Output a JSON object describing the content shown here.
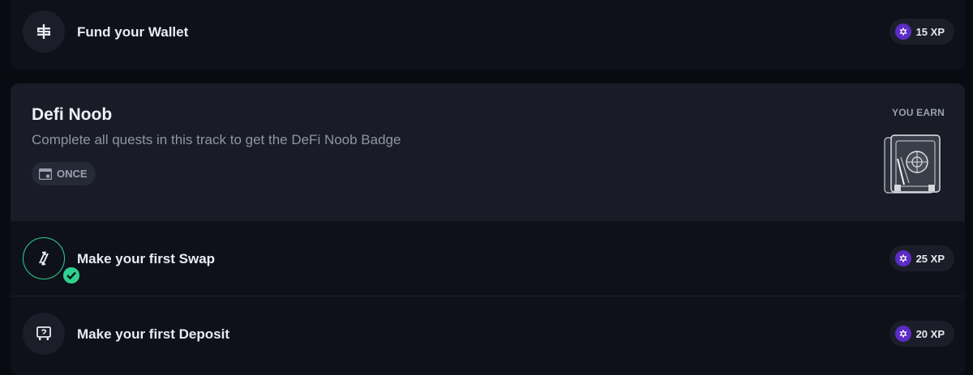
{
  "quests_top": {
    "fund_wallet": {
      "label": "Fund your Wallet",
      "xp": "15 XP",
      "icon": "dollar-icon"
    }
  },
  "track": {
    "title": "Defi Noob",
    "description": "Complete all quests in this track to get the DeFi Noob Badge",
    "frequency": "ONCE",
    "reward_label": "YOU EARN",
    "reward_icon": "vault-badge-icon",
    "quests": [
      {
        "label": "Make your first Swap",
        "xp": "25 XP",
        "icon": "swap-icon",
        "completed": true
      },
      {
        "label": "Make your first Deposit",
        "xp": "20 XP",
        "icon": "deposit-icon",
        "completed": false
      }
    ]
  },
  "colors": {
    "background": "#090b12",
    "card": "#0e111a",
    "header": "#191c27",
    "accent_green": "#2fd08f",
    "xp_purple": "#5b2cc4"
  }
}
